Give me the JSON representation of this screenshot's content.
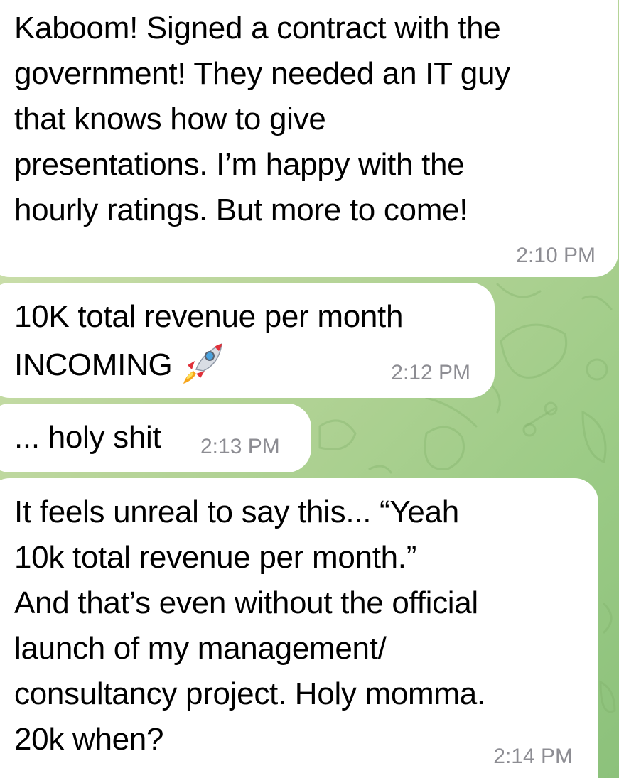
{
  "colors": {
    "bubble": "#ffffff",
    "timestamp": "#8d8d93",
    "wallpaper_start": "#d9e6b8",
    "wallpaper_end": "#8cc17b"
  },
  "messages": [
    {
      "text": "Kaboom! Signed a contract with the\ngovernment! They needed an IT guy\nthat knows how to give\npresentations. I’m happy with the\nhourly ratings. But more to come!",
      "time": "2:10 PM"
    },
    {
      "text_line1": "10K total revenue per month",
      "text_line2": "INCOMING",
      "emoji_icon": "rocket-icon",
      "time": "2:12 PM"
    },
    {
      "text": "... holy shit",
      "time": "2:13 PM"
    },
    {
      "text": "It feels unreal to say this... “Yeah\n10k total revenue per month.”\nAnd that’s even without the official\nlaunch of my management/\nconsultancy project. Holy momma.\n20k when?",
      "time": "2:14 PM"
    }
  ]
}
